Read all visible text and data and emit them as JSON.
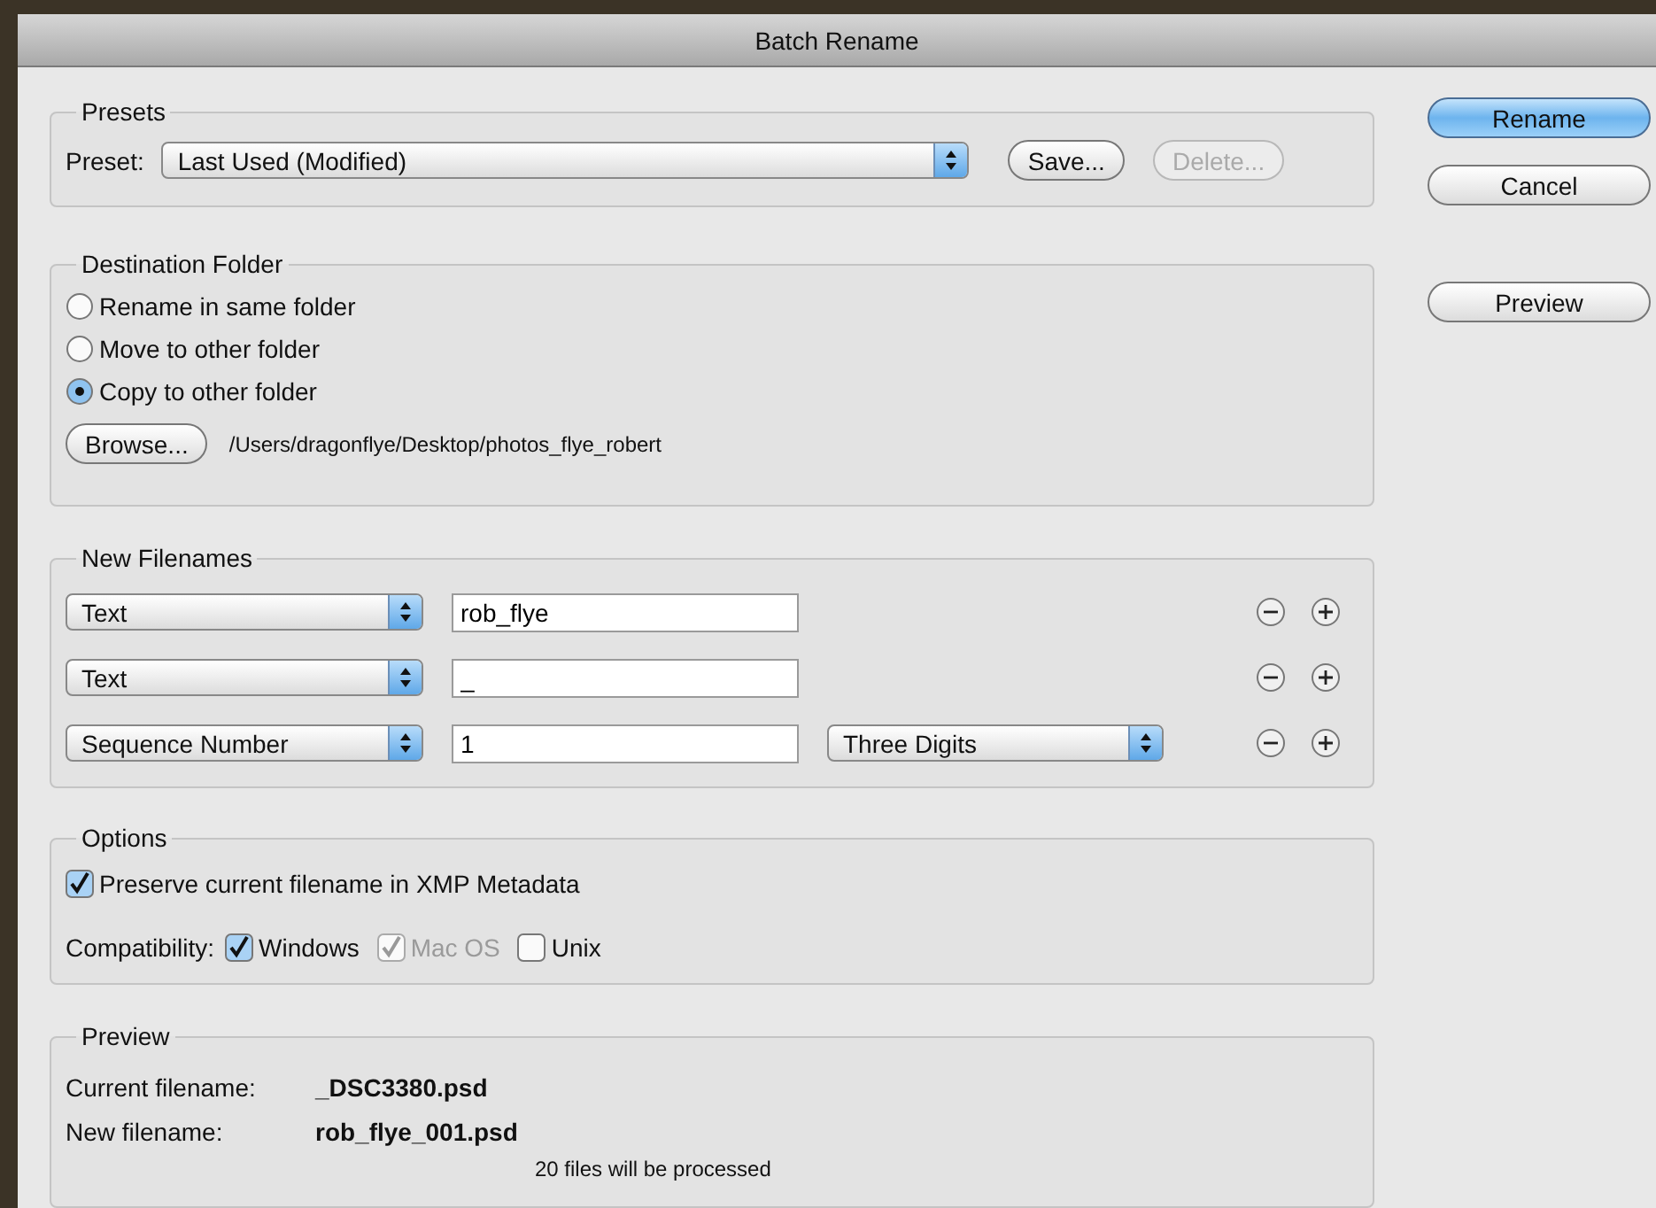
{
  "window": {
    "title": "Batch Rename"
  },
  "actions": [
    {
      "label": "Rename",
      "kind": "default"
    },
    {
      "label": "Cancel",
      "kind": "normal"
    },
    {
      "label": "Preview",
      "kind": "spaced"
    }
  ],
  "presets": {
    "legend": "Presets",
    "label": "Preset:",
    "value": "Last Used (Modified)",
    "buttons": [
      {
        "label": "Save...",
        "disabled": false
      },
      {
        "label": "Delete...",
        "disabled": true
      }
    ]
  },
  "destination": {
    "legend": "Destination Folder",
    "options": [
      {
        "label": "Rename in same folder",
        "selected": false
      },
      {
        "label": "Move to other folder",
        "selected": false
      },
      {
        "label": "Copy to other folder",
        "selected": true
      }
    ],
    "browse_button": "Browse...",
    "path": "/Users/dragonflye/Desktop/photos_flye_robert"
  },
  "new_filenames": {
    "legend": "New Filenames",
    "rows": [
      {
        "type": "Text",
        "value": "rob_flye"
      },
      {
        "type": "Text",
        "value": "_"
      },
      {
        "type": "Sequence Number",
        "value": "1",
        "format": "Three Digits"
      }
    ]
  },
  "options": {
    "legend": "Options",
    "preserve": {
      "label": "Preserve current filename in XMP Metadata",
      "checked": true
    },
    "compatibility": {
      "label": "Compatibility:",
      "items": [
        {
          "label": "Windows",
          "checked": true,
          "disabled": false
        },
        {
          "label": "Mac OS",
          "checked": true,
          "disabled": true
        },
        {
          "label": "Unix",
          "checked": false,
          "disabled": false
        }
      ]
    }
  },
  "preview": {
    "legend": "Preview",
    "current_label": "Current filename:",
    "current_value": "_DSC3380.psd",
    "new_label": "New filename:",
    "new_value": "rob_flye_001.psd",
    "note": "20 files will be processed"
  }
}
